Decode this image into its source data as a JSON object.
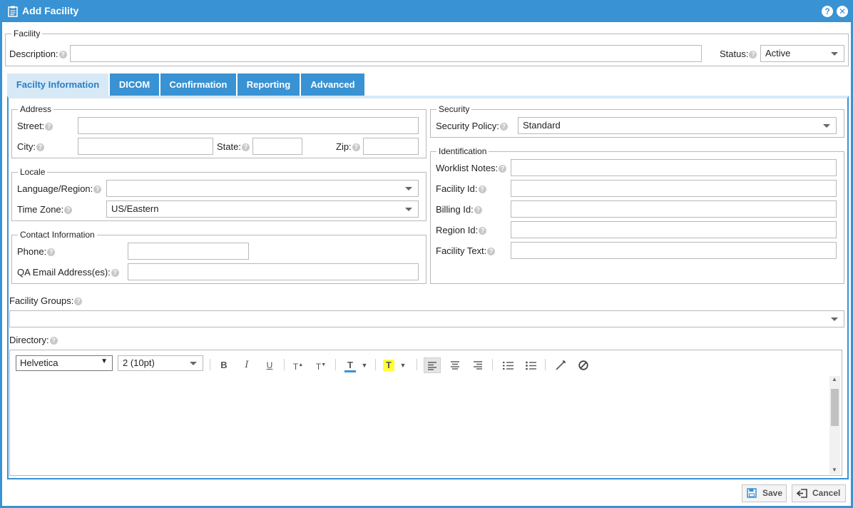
{
  "window": {
    "title": "Add Facility"
  },
  "facility": {
    "legend": "Facility",
    "description_label": "Description:",
    "description_value": "",
    "status_label": "Status:",
    "status_value": "Active"
  },
  "tabs": [
    {
      "label": "Facilty Information",
      "active": true
    },
    {
      "label": "DICOM",
      "active": false
    },
    {
      "label": "Confirmation",
      "active": false
    },
    {
      "label": "Reporting",
      "active": false
    },
    {
      "label": "Advanced",
      "active": false
    }
  ],
  "address": {
    "legend": "Address",
    "street_label": "Street:",
    "city_label": "City:",
    "state_label": "State:",
    "zip_label": "Zip:"
  },
  "locale": {
    "legend": "Locale",
    "language_label": "Language/Region:",
    "language_value": "",
    "timezone_label": "Time Zone:",
    "timezone_value": "US/Eastern"
  },
  "contact": {
    "legend": "Contact Information",
    "phone_label": "Phone:",
    "qa_email_label": "QA Email Address(es):"
  },
  "security": {
    "legend": "Security",
    "policy_label": "Security Policy:",
    "policy_value": "Standard"
  },
  "identification": {
    "legend": "Identification",
    "worklist_notes_label": "Worklist Notes:",
    "facility_id_label": "Facility Id:",
    "billing_id_label": "Billing Id:",
    "region_id_label": "Region Id:",
    "facility_text_label": "Facility Text:"
  },
  "facility_groups": {
    "label": "Facility Groups:"
  },
  "directory": {
    "label": "Directory:",
    "font_value": "Helvetica",
    "size_value": "2 (10pt)"
  },
  "footer": {
    "save_label": "Save",
    "cancel_label": "Cancel"
  },
  "colors": {
    "accent": "#3892d3",
    "active_tab_bg": "#d7e9f7",
    "highlight": "#ffff33"
  }
}
